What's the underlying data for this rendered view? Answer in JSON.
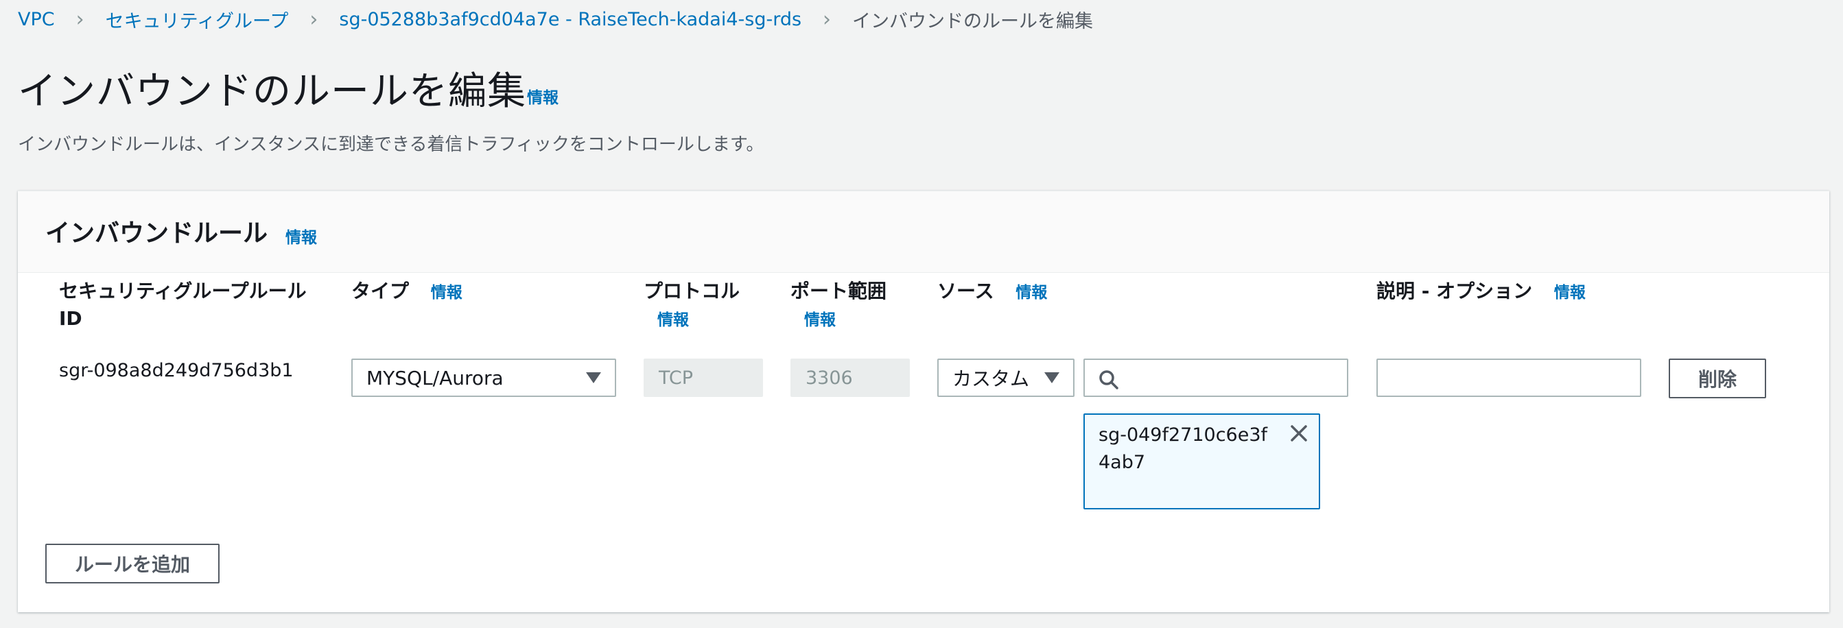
{
  "breadcrumb": {
    "items": [
      "VPC",
      "セキュリティグループ",
      "sg-05288b3af9cd04a7e - RaiseTech-kadai4-sg-rds"
    ],
    "current": "インバウンドのルールを編集"
  },
  "page": {
    "title": "インバウンドのルールを編集",
    "info": "情報",
    "description": "インバウンドルールは、インスタンスに到達できる着信トラフィックをコントロールします。"
  },
  "panel": {
    "title": "インバウンドルール",
    "info": "情報"
  },
  "columns": {
    "rule_id_line1": "セキュリティグループルール",
    "rule_id_line2": "ID",
    "type": "タイプ",
    "protocol": "プロトコル",
    "port_range": "ポート範囲",
    "source": "ソース",
    "description": "説明 - オプション",
    "info": "情報"
  },
  "rule": {
    "id": "sgr-098a8d249d756d3b1",
    "type": "MYSQL/Aurora",
    "protocol": "TCP",
    "port": "3306",
    "source_type": "カスタム",
    "source_search": "",
    "source_token": "sg-049f2710c6e3f4ab7",
    "description": "",
    "delete_label": "削除"
  },
  "actions": {
    "add_rule": "ルールを追加"
  },
  "icons": {
    "breadcrumb_separator": "chevron-right-icon",
    "caret": "caret-down-icon",
    "search": "search-icon",
    "close": "close-icon"
  },
  "colors": {
    "link": "#0073bb",
    "background": "#f2f3f3",
    "token_border": "#0073bb"
  }
}
